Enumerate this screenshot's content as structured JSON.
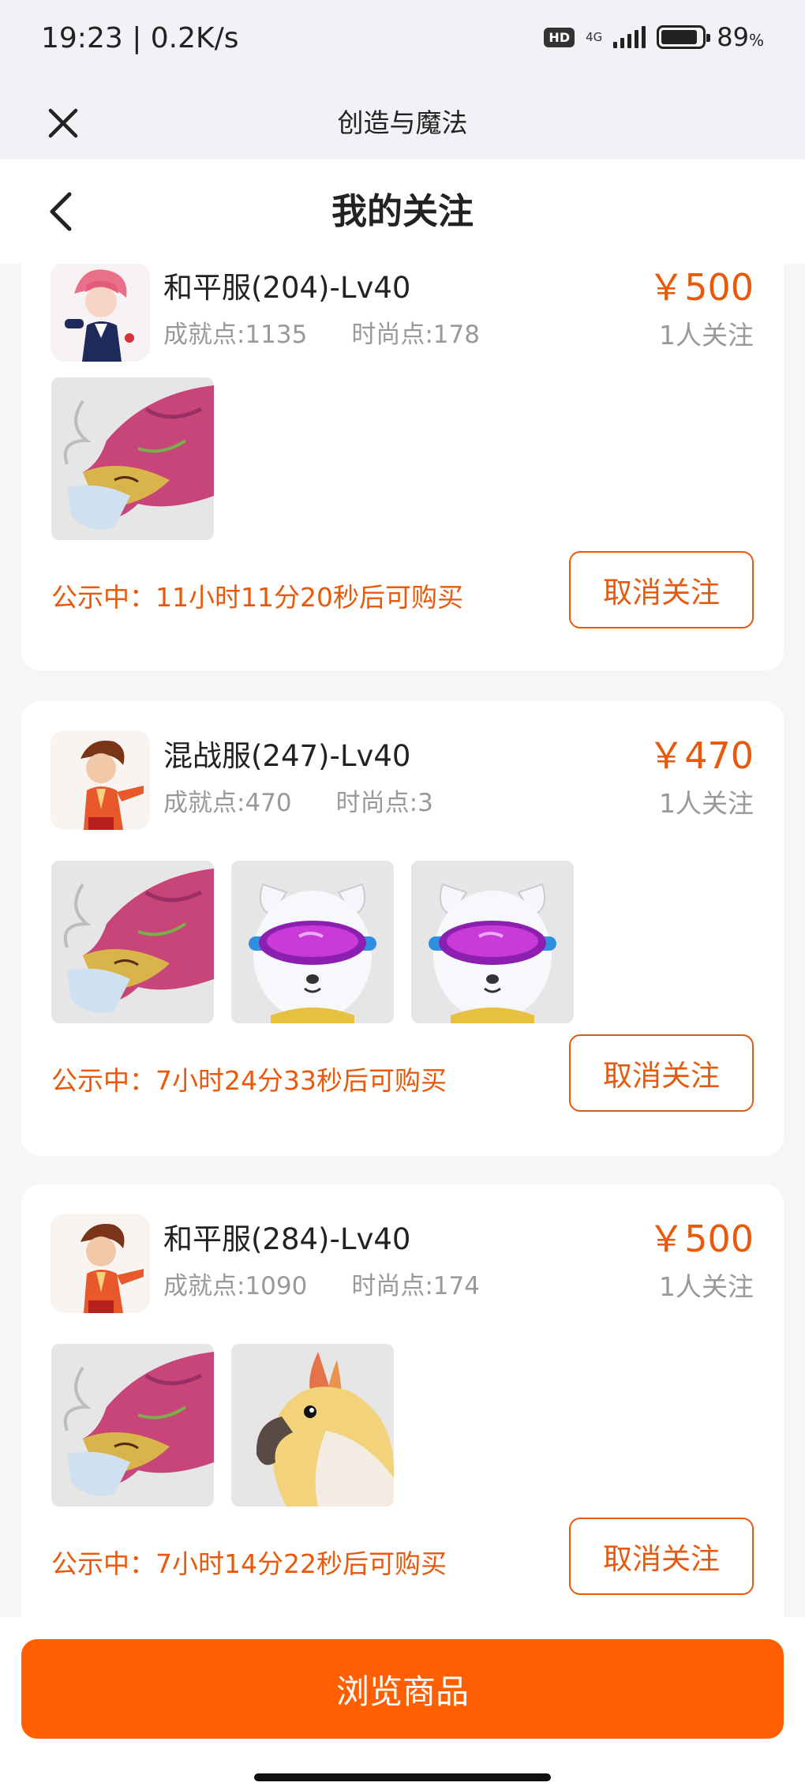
{
  "status_bar": {
    "time_speed": "19:23 | 0.2K/s",
    "hd_badge": "HD",
    "network": "4G",
    "battery_number": "89",
    "battery_unit": "%",
    "battery_level": 0.89
  },
  "miniapp": {
    "title": "创造与魔法"
  },
  "nav": {
    "title": "我的关注"
  },
  "colors": {
    "accent": "#e8590c",
    "button": "#ff5f00",
    "muted": "#999999"
  },
  "listings": [
    {
      "server": "和平服(204)-Lv40",
      "achievement": "成就点:1135",
      "fashion": "时尚点:178",
      "price": "￥500",
      "followers": "1人关注",
      "items": [
        "dragon-mount"
      ],
      "countdown": "公示中：11小时11分20秒后可购买",
      "unfollow_label": "取消关注"
    },
    {
      "server": "混战服(247)-Lv40",
      "achievement": "成就点:470",
      "fashion": "时尚点:3",
      "price": "￥470",
      "followers": "1人关注",
      "items": [
        "dragon-mount",
        "goggles-bear",
        "goggles-bear"
      ],
      "countdown": "公示中：7小时24分33秒后可购买",
      "unfollow_label": "取消关注"
    },
    {
      "server": "和平服(284)-Lv40",
      "achievement": "成就点:1090",
      "fashion": "时尚点:174",
      "price": "￥500",
      "followers": "1人关注",
      "items": [
        "dragon-mount",
        "cockatoo-pet"
      ],
      "countdown": "公示中：7小时14分22秒后可购买",
      "unfollow_label": "取消关注"
    }
  ],
  "footer": {
    "browse_label": "浏览商品"
  }
}
